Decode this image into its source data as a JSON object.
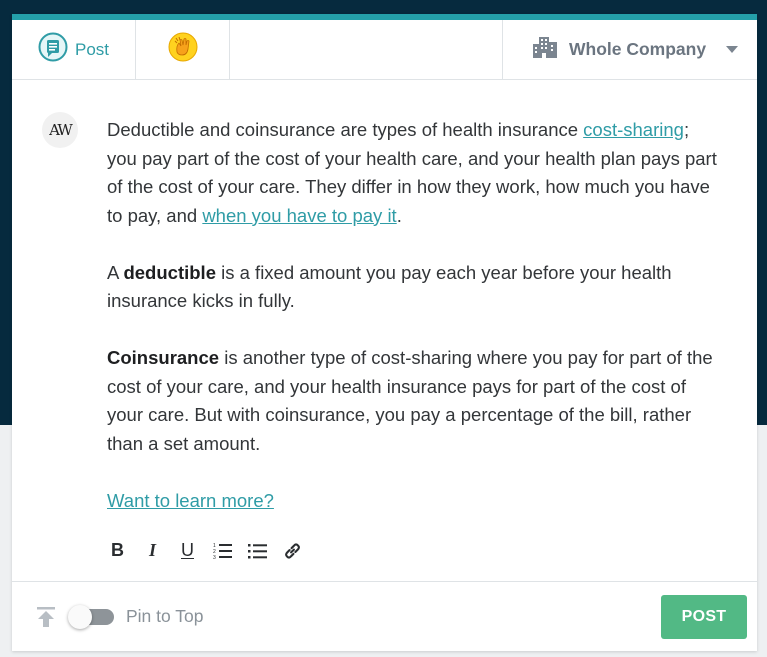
{
  "header": {
    "post_tab_label": "Post",
    "post_tab_icon": "post-bubble-icon",
    "kudos_tab_icon": "clapping-hands-icon",
    "audience_label": "Whole Company",
    "audience_icon": "building-icon"
  },
  "author": {
    "avatar_text": "AW"
  },
  "post": {
    "p1_a": "Deductible and coinsurance are types of health insurance ",
    "p1_link1": "cost-sharing",
    "p1_b": "; you pay part of the cost of your health care, and your health plan pays part of the cost of your care. They differ in how they work, how much you have to pay, and ",
    "p1_link2": "when you have to pay it",
    "p1_c": ".",
    "p2_a": "A ",
    "p2_bold": "deductible",
    "p2_b": " is a fixed amount you pay each year before your health insurance kicks in fully.",
    "p3_bold": "Coinsurance",
    "p3_b": " is another type of cost-sharing where you pay for part of the cost of your care, and your health insurance pays for part of the cost of your care. But with coinsurance, you pay a percentage of the bill, rather than a set amount.",
    "p4_link": "Want to learn more?"
  },
  "toolbar": {
    "bold_glyph": "B",
    "italic_glyph": "I",
    "underline_glyph": "U"
  },
  "footer": {
    "pin_label": "Pin to Top",
    "pin_enabled": false,
    "post_button_label": "POST"
  },
  "colors": {
    "accent": "#24a0aa",
    "post_button": "#52b985",
    "dark_background": "#062a3e"
  }
}
